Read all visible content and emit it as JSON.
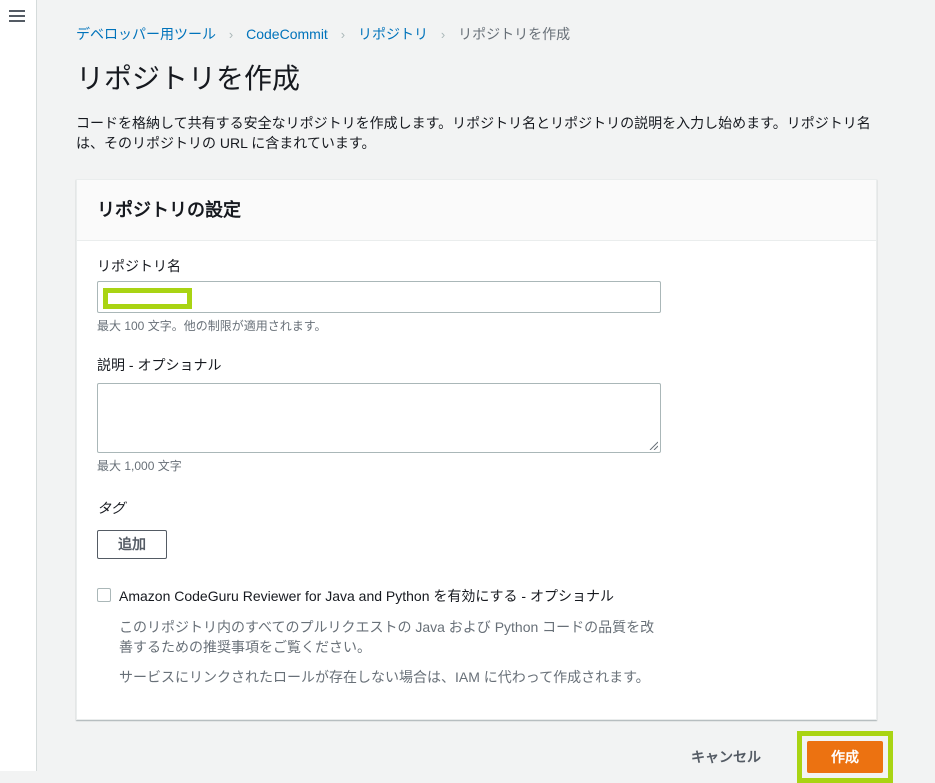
{
  "breadcrumb": {
    "separator": "›",
    "items": [
      {
        "label": "デベロッパー用ツール"
      },
      {
        "label": "CodeCommit"
      },
      {
        "label": "リポジトリ"
      },
      {
        "label": "リポジトリを作成"
      }
    ]
  },
  "page": {
    "title": "リポジトリを作成",
    "description": "コードを格納して共有する安全なリポジトリを作成します。リポジトリ名とリポジトリの説明を入力し始めます。リポジトリ名は、そのリポジトリの URL に含まれています。"
  },
  "form": {
    "card_title": "リポジトリの設定",
    "repository_name": {
      "label": "リポジトリ名",
      "value": "",
      "hint": "最大 100 文字。他の制限が適用されます。"
    },
    "description_field": {
      "label": "説明 - オプショナル",
      "value": "",
      "hint": "最大 1,000 文字"
    },
    "tags": {
      "label": "タグ",
      "add_button_label": "追加"
    },
    "codeguru": {
      "checkbox_label": "Amazon CodeGuru Reviewer for Java and Python を有効にする - オプショナル",
      "checked": false,
      "description": "このリポジトリ内のすべてのプルリクエストの Java および Python コードの品質を改善するための推奨事項をご覧ください。",
      "note": "サービスにリンクされたロールが存在しない場合は、IAM に代わって作成されます。"
    }
  },
  "actions": {
    "cancel_label": "キャンセル",
    "create_label": "作成"
  },
  "icons": {
    "menu": "hamburger-icon",
    "resize": "resize-handle-icon"
  },
  "colors": {
    "link_blue": "#0073bb",
    "primary_orange": "#ec7211",
    "annotation_green": "#a9d413",
    "text_dark": "#16191f",
    "text_gray": "#687078",
    "border_gray": "#aab7b8"
  }
}
